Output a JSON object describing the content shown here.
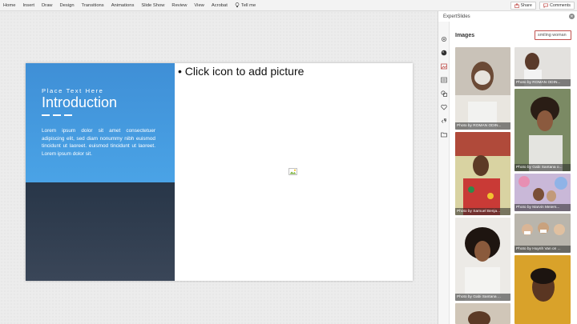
{
  "ribbon": {
    "menu": [
      "Home",
      "Insert",
      "Draw",
      "Design",
      "Transitions",
      "Animations",
      "Slide Show",
      "Review",
      "View",
      "Acrobat"
    ],
    "tell_me": "Tell me",
    "share": "Share",
    "comments": "Comments"
  },
  "slide": {
    "eyebrow": "Place Text Here",
    "title": "Introduction",
    "body": "Lorem ipsum dolor sit amet consectetuer adipiscing elit, sed diam nonummy nibh euismod tincidunt ut laoreet. euismod tincidunt ut laoreet. Lorem ipsum dolor sit.",
    "placeholder": "• Click icon to add picture",
    "colors": {
      "panel_top": "#4aa3e6",
      "panel_bottom": "#2f3c4f"
    }
  },
  "pane": {
    "title": "ExpertSlides",
    "section": "Images",
    "search_value": "smiling woman",
    "sidebar_icons": [
      "gear-icon",
      "palette-icon",
      "image-icon",
      "list-icon",
      "shapes-icon",
      "heart-icon",
      "link-icon",
      "folder-icon"
    ],
    "images": [
      {
        "caption": "Photo by ROMAN ODIN..."
      },
      {
        "caption": "Photo by ROMAN ODIN..."
      },
      {
        "caption": "Photo by Gabi Santana o..."
      },
      {
        "caption": "Photo by Samuel Benja..."
      },
      {
        "caption": "Photo by Marvin Meiers..."
      },
      {
        "caption": "Photo by Gabi Santana ..."
      },
      {
        "caption": "Photo by Huynh Van on ..."
      },
      {
        "caption": ""
      },
      {
        "caption": ""
      }
    ]
  }
}
